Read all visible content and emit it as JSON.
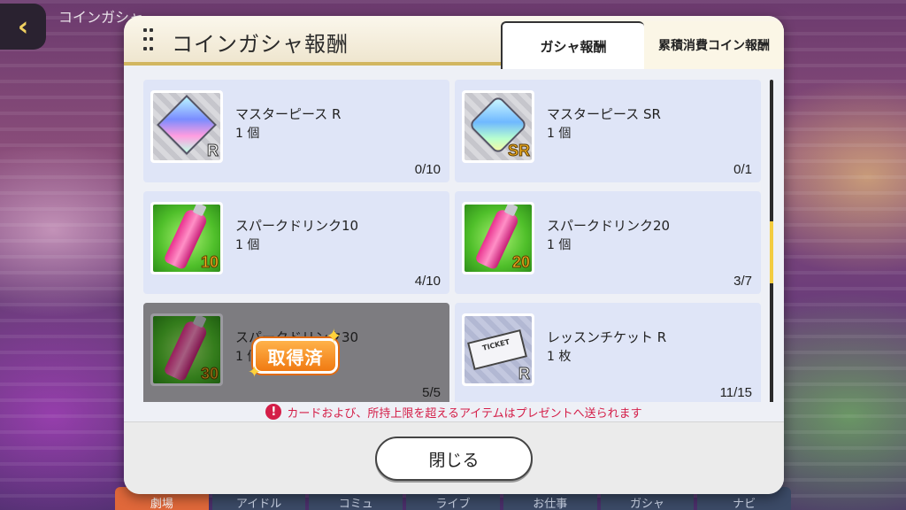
{
  "background": {
    "scene_title": "コインガシャ",
    "bottom_nav": [
      "劇場",
      "アイドル",
      "コミュ",
      "ライブ",
      "お仕事",
      "ガシャ",
      "ナビ"
    ]
  },
  "modal": {
    "title": "コインガシャ報酬",
    "tabs": [
      {
        "label": "ガシャ報酬",
        "active": true
      },
      {
        "label": "累積消費コイン報酬",
        "active": false
      }
    ],
    "items": [
      {
        "name": "マスターピース R",
        "qty": "1 個",
        "progress": "0/10",
        "rank": "R",
        "icon": "gem-icon",
        "claimed": false
      },
      {
        "name": "マスターピース SR",
        "qty": "1 個",
        "progress": "0/1",
        "rank": "SR",
        "icon": "gem-sr-icon",
        "claimed": false
      },
      {
        "name": "スパークドリンク10",
        "qty": "1 個",
        "progress": "4/10",
        "rank": "10",
        "icon": "drink-icon",
        "claimed": false
      },
      {
        "name": "スパークドリンク20",
        "qty": "1 個",
        "progress": "3/7",
        "rank": "20",
        "icon": "drink-icon",
        "claimed": false
      },
      {
        "name": "スパークドリンク30",
        "qty": "1 個",
        "progress": "5/5",
        "rank": "30",
        "icon": "drink-icon",
        "claimed": true
      },
      {
        "name": "レッスンチケット R",
        "qty": "1 枚",
        "progress": "11/15",
        "rank": "R",
        "icon": "ticket-icon",
        "claimed": false
      }
    ],
    "claimed_stamp": "取得済",
    "ticket_text": "TICKET",
    "notice": "カードおよび、所持上限を超えるアイテムはプレゼントへ送られます",
    "close_label": "閉じる"
  },
  "colors": {
    "header_border": "#d2b660",
    "card_bg": "#dfe5f7",
    "claimed_bg": "#7d7c80",
    "stamp": "#f07a12",
    "notice": "#d41e48",
    "scroll_thumb": "#f3cc40"
  }
}
